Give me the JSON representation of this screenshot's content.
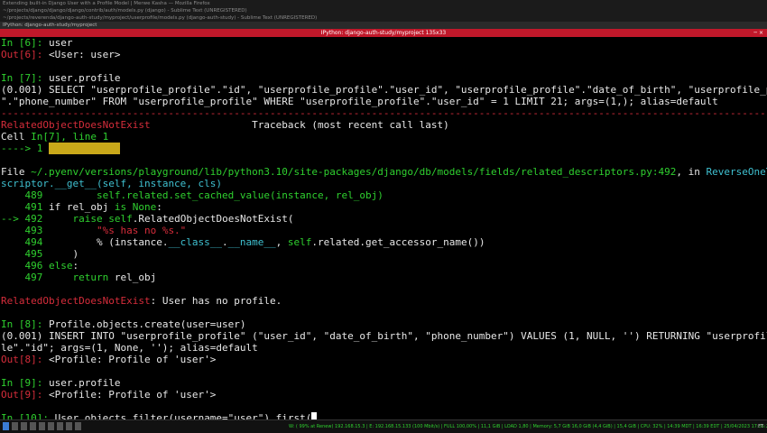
{
  "background_windows": [
    "Extending built-in Django User with a Profile Model | Merwe Kasha — Mozilla Firefox",
    "~/projects/django/django/django/contrib/auth/models.py (django) - Sublime Text (UNREGISTERED)",
    "~/projects/reverenda/django-auth-study/myproject/userprofile/models.py (django-auth-study) - Sublime Text (UNREGISTERED)"
  ],
  "tab": {
    "label": "IPython: django-auth-study/myproject"
  },
  "window": {
    "title": "IPython: django-auth-study/myproject 135x33"
  },
  "terminal": {
    "lines": [
      [
        {
          "t": "In [",
          "c": "g"
        },
        {
          "t": "6",
          "c": "g"
        },
        {
          "t": "]: ",
          "c": "g"
        },
        {
          "t": "user"
        }
      ],
      [
        {
          "t": "Out[6]: ",
          "c": "r"
        },
        {
          "t": "<User: user>"
        }
      ],
      [],
      [
        {
          "t": "In [",
          "c": "g"
        },
        {
          "t": "7",
          "c": "g"
        },
        {
          "t": "]: ",
          "c": "g"
        },
        {
          "t": "user.profile"
        }
      ],
      [
        {
          "t": "(0.001) SELECT \"userprofile_profile\".\"id\", \"userprofile_profile\".\"user_id\", \"userprofile_profile\".\"date_of_birth\", \"userprofile_profile"
        }
      ],
      [
        {
          "t": "\".\"phone_number\" FROM \"userprofile_profile\" WHERE \"userprofile_profile\".\"user_id\" = 1 LIMIT 21; args=(1,); alias=default"
        }
      ],
      [
        {
          "t": "---------------------------------------------------------------------------------------------------------------------------------------",
          "c": "r"
        }
      ],
      [
        {
          "t": "RelatedObjectDoesNotExist",
          "c": "r"
        },
        {
          "t": "                 Traceback (most recent call last)"
        }
      ],
      [
        {
          "t": "Cell "
        },
        {
          "t": "In[7], line 1",
          "c": "g"
        }
      ],
      [
        {
          "t": "----> 1 ",
          "c": "g"
        },
        {
          "t": "user.profile",
          "c": "hl"
        }
      ],
      [],
      [
        {
          "t": "File "
        },
        {
          "t": "~/.pyenv/versions/playground/lib/python3.10/site-packages/django/db/models/fields/related_descriptors.py:492",
          "c": "g"
        },
        {
          "t": ", in "
        },
        {
          "t": "ReverseOneToOneDe",
          "c": "c"
        }
      ],
      [
        {
          "t": "scriptor.__get__",
          "c": "c"
        },
        {
          "t": "(self, instance, cls)",
          "c": "c"
        }
      ],
      [
        {
          "t": "    489 ",
          "c": "g"
        },
        {
          "t": "        self.related.set_cached_value(instance, rel_obj)",
          "c": "g"
        }
      ],
      [
        {
          "t": "    491 ",
          "c": "g"
        },
        {
          "t": "if rel_obj "
        },
        {
          "t": "is",
          "c": "g"
        },
        {
          "t": " "
        },
        {
          "t": "None",
          "c": "g"
        },
        {
          "t": ":"
        }
      ],
      [
        {
          "t": "--> 492 ",
          "c": "g"
        },
        {
          "t": "    "
        },
        {
          "t": "raise",
          "c": "g"
        },
        {
          "t": " "
        },
        {
          "t": "self",
          "c": "g"
        },
        {
          "t": ".RelatedObjectDoesNotExist("
        }
      ],
      [
        {
          "t": "    493 ",
          "c": "g"
        },
        {
          "t": "        "
        },
        {
          "t": "\"%s has no %s.\"",
          "c": "r"
        }
      ],
      [
        {
          "t": "    494 ",
          "c": "g"
        },
        {
          "t": "        % (instance."
        },
        {
          "t": "__class__",
          "c": "c"
        },
        {
          "t": "."
        },
        {
          "t": "__name__",
          "c": "c"
        },
        {
          "t": ", "
        },
        {
          "t": "self",
          "c": "g"
        },
        {
          "t": ".related.get_accessor_name())"
        }
      ],
      [
        {
          "t": "    495 ",
          "c": "g"
        },
        {
          "t": "    )"
        }
      ],
      [
        {
          "t": "    496 ",
          "c": "g"
        },
        {
          "t": "else",
          "c": "g"
        },
        {
          "t": ":"
        }
      ],
      [
        {
          "t": "    497 ",
          "c": "g"
        },
        {
          "t": "    "
        },
        {
          "t": "return",
          "c": "g"
        },
        {
          "t": " rel_obj"
        }
      ],
      [],
      [
        {
          "t": "RelatedObjectDoesNotExist",
          "c": "r"
        },
        {
          "t": ": User has no profile."
        }
      ],
      [],
      [
        {
          "t": "In [",
          "c": "g"
        },
        {
          "t": "8",
          "c": "g"
        },
        {
          "t": "]: ",
          "c": "g"
        },
        {
          "t": "Profile.objects.create(user=user)"
        }
      ],
      [
        {
          "t": "(0.001) INSERT INTO \"userprofile_profile\" (\"user_id\", \"date_of_birth\", \"phone_number\") VALUES (1, NULL, '') RETURNING \"userprofile_profi"
        }
      ],
      [
        {
          "t": "le\".\"id\"; args=(1, None, ''); alias=default"
        }
      ],
      [
        {
          "t": "Out[8]: ",
          "c": "r"
        },
        {
          "t": "<Profile: Profile of 'user'>"
        }
      ],
      [],
      [
        {
          "t": "In [",
          "c": "g"
        },
        {
          "t": "9",
          "c": "g"
        },
        {
          "t": "]: ",
          "c": "g"
        },
        {
          "t": "user.profile"
        }
      ],
      [
        {
          "t": "Out[9]: ",
          "c": "r"
        },
        {
          "t": "<Profile: Profile of 'user'>"
        }
      ],
      [],
      [
        {
          "t": "In [",
          "c": "g"
        },
        {
          "t": "10",
          "c": "g"
        },
        {
          "t": "]: ",
          "c": "g"
        },
        {
          "t": "User.objects.filter(username=\"user\").first("
        }
      ]
    ]
  },
  "statusbar": {
    "workspaces": [
      "1",
      "2",
      "3",
      "4",
      "5",
      "6",
      "7",
      "8",
      "9"
    ],
    "info": "W: ( 99% at Renew) 192.168.15.3 | E: 192.168.15.133 (100 Mbit/s) | FULL 100,00% | 11,1 GiB | LOAD 1,80 | Memory: 5,7 GiB 16,0 GiB (4,4 GiB) | 15,4 GiB | CPU: 32% | 14:39 MDT | 16:39 EDT | 25/04/2023 17:35:25",
    "tray": "FT"
  },
  "colors": {
    "green": "#2fd02f",
    "red": "#d62d3b",
    "cyan": "#3fc0d0",
    "highlight": "#c9a81a",
    "titlebar": "#c0182a"
  }
}
